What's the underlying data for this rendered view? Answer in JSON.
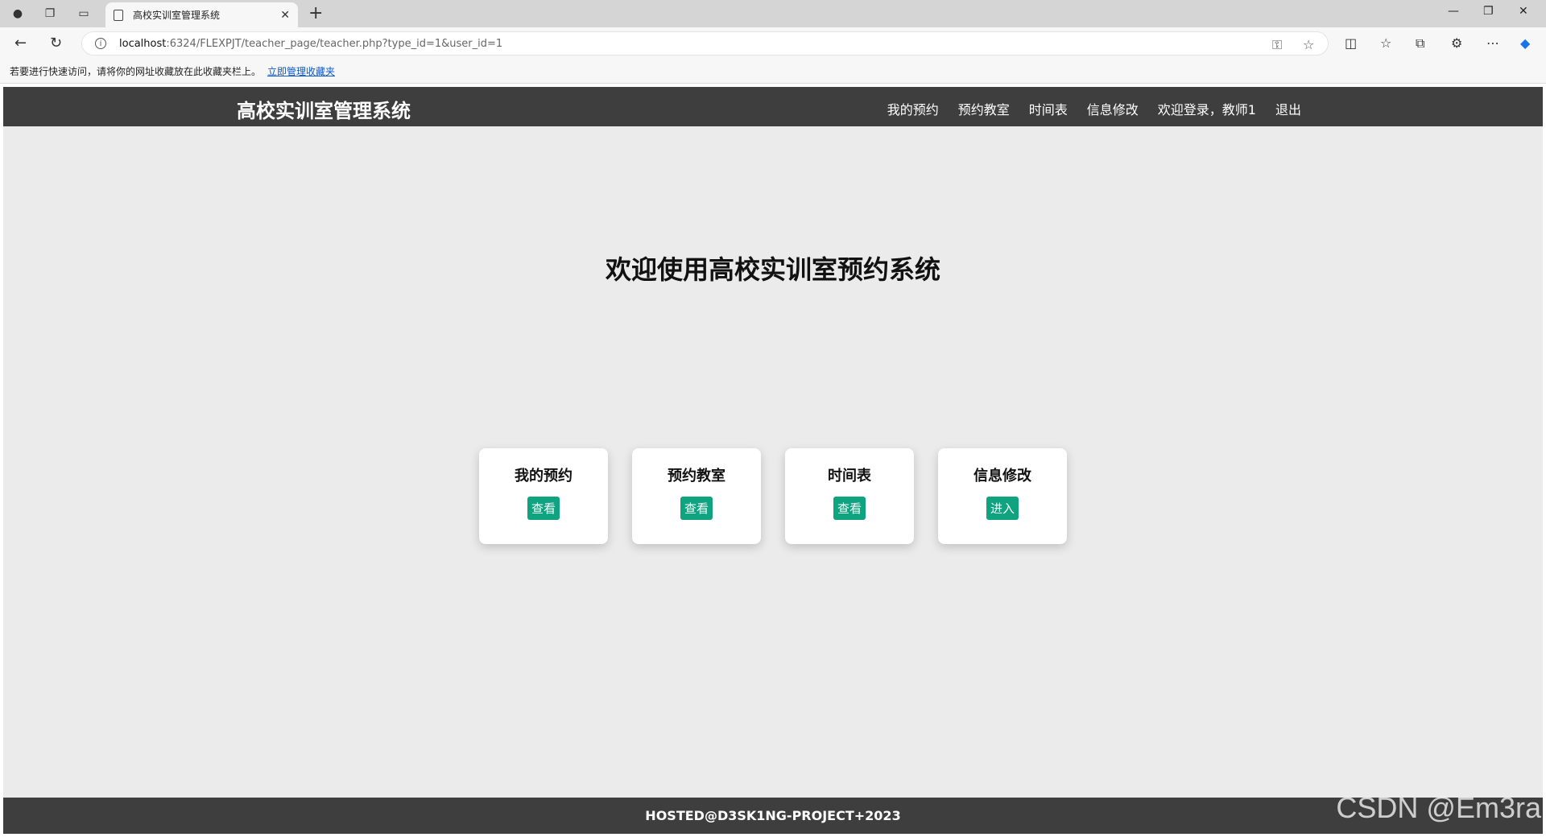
{
  "browser": {
    "tab_title": "高校实训室管理系统",
    "url_host": "localhost",
    "url_rest": ":6324/FLEXPJT/teacher_page/teacher.php?type_id=1&user_id=1",
    "favbar_text": "若要进行快速访问，请将你的网址收藏放在此收藏夹栏上。",
    "favbar_link": "立即管理收藏夹"
  },
  "header": {
    "title": "高校实训室管理系统",
    "nav": [
      "我的预约",
      "预约教室",
      "时间表",
      "信息修改",
      "欢迎登录，教师1",
      "退出"
    ]
  },
  "main": {
    "welcome": "欢迎使用高校实训室预约系统",
    "cards": [
      {
        "title": "我的预约",
        "button": "查看"
      },
      {
        "title": "预约教室",
        "button": "查看"
      },
      {
        "title": "时间表",
        "button": "查看"
      },
      {
        "title": "信息修改",
        "button": "进入"
      }
    ]
  },
  "footer": {
    "text": "HOSTED@D3SK1NG-PROJECT+2023"
  },
  "watermark": "CSDN @Em3ra",
  "colors": {
    "header_bg": "#3e3e3e",
    "page_bg": "#ebebeb",
    "button_green": "#10a37f"
  }
}
